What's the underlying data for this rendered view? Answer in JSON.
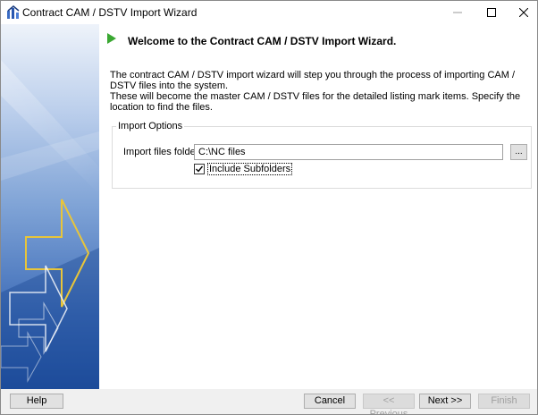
{
  "window": {
    "title": "Contract CAM / DSTV Import Wizard"
  },
  "content": {
    "heading": "Welcome to the Contract CAM / DSTV Import Wizard.",
    "intro": "The contract CAM / DSTV import wizard will step you through the process of importing CAM / DSTV files into the system.\nThese will become the master CAM / DSTV files for the detailed listing mark items. Specify the location to find the files."
  },
  "import_options": {
    "legend": "Import Options",
    "folder_label": "Import files folder",
    "folder_value": "C:\\NC files",
    "browse_label": "...",
    "include_subfolders_label": "Include Subfolders",
    "include_subfolders_checked": true
  },
  "footer": {
    "help": "Help",
    "cancel": "Cancel",
    "previous": "<< Previous",
    "next": "Next >>",
    "finish": "Finish"
  },
  "colors": {
    "banner_top": "#e6eef8",
    "banner_mid": "#7fa3d6",
    "banner_bottom": "#1f4fa0",
    "arrow_accent": "#e8c53a",
    "start_icon": "#3aa832"
  }
}
